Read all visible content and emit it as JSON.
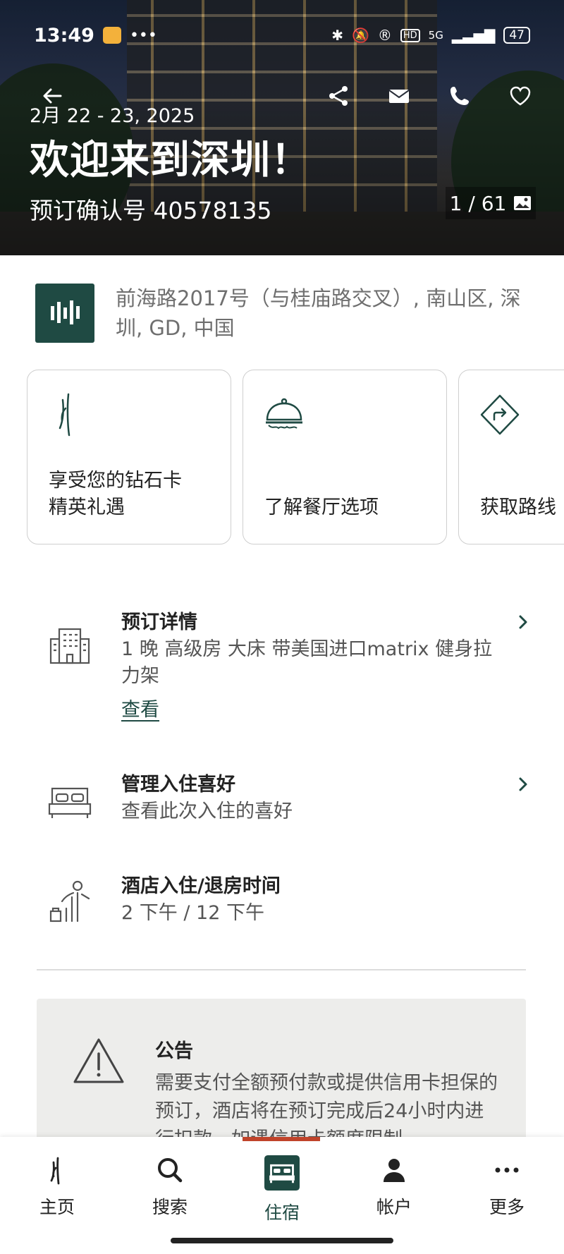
{
  "status_bar": {
    "time": "13:49",
    "network": "5G",
    "battery": "47"
  },
  "hero": {
    "dates": "2月 22 - 23, 2025",
    "welcome": "欢迎来到深圳！",
    "confirmation": "预订确认号 40578135",
    "photo_counter": "1 / 61"
  },
  "hotel": {
    "address": "前海路2017号（与桂庙路交叉）, 南山区, 深圳, GD, 中国"
  },
  "quick_cards": [
    {
      "label_line1": "享受您的钻石卡",
      "label_line2": "精英礼遇",
      "icon": "brand-icon"
    },
    {
      "label_line1": "了解餐厅选项",
      "icon": "dining-cloche-icon"
    },
    {
      "label_line1": "获取路线",
      "icon": "directions-icon"
    }
  ],
  "reservation": {
    "title": "预订详情",
    "details": "1 晚 高级房 大床 带美国进口matrix 健身拉力架",
    "view_link": "查看"
  },
  "preferences": {
    "title": "管理入住喜好",
    "subtitle": "查看此次入住的喜好"
  },
  "checkin": {
    "title": "酒店入住/退房时间",
    "times": "2 下午 / 12 下午"
  },
  "notice": {
    "title": "公告",
    "text": "需要支付全额预付款或提供信用卡担保的预订，酒店将在预订完成后24小时内进行扣款，如遇信用卡额度限制"
  },
  "tabs": [
    {
      "label": "主页",
      "icon": "home-brand-icon"
    },
    {
      "label": "搜索",
      "icon": "search-icon"
    },
    {
      "label": "住宿",
      "icon": "bed-icon",
      "active": true
    },
    {
      "label": "帐户",
      "icon": "person-icon"
    },
    {
      "label": "更多",
      "icon": "more-icon"
    }
  ],
  "colors": {
    "brand": "#1f4a43",
    "tab_indicator": "#c0432a"
  }
}
